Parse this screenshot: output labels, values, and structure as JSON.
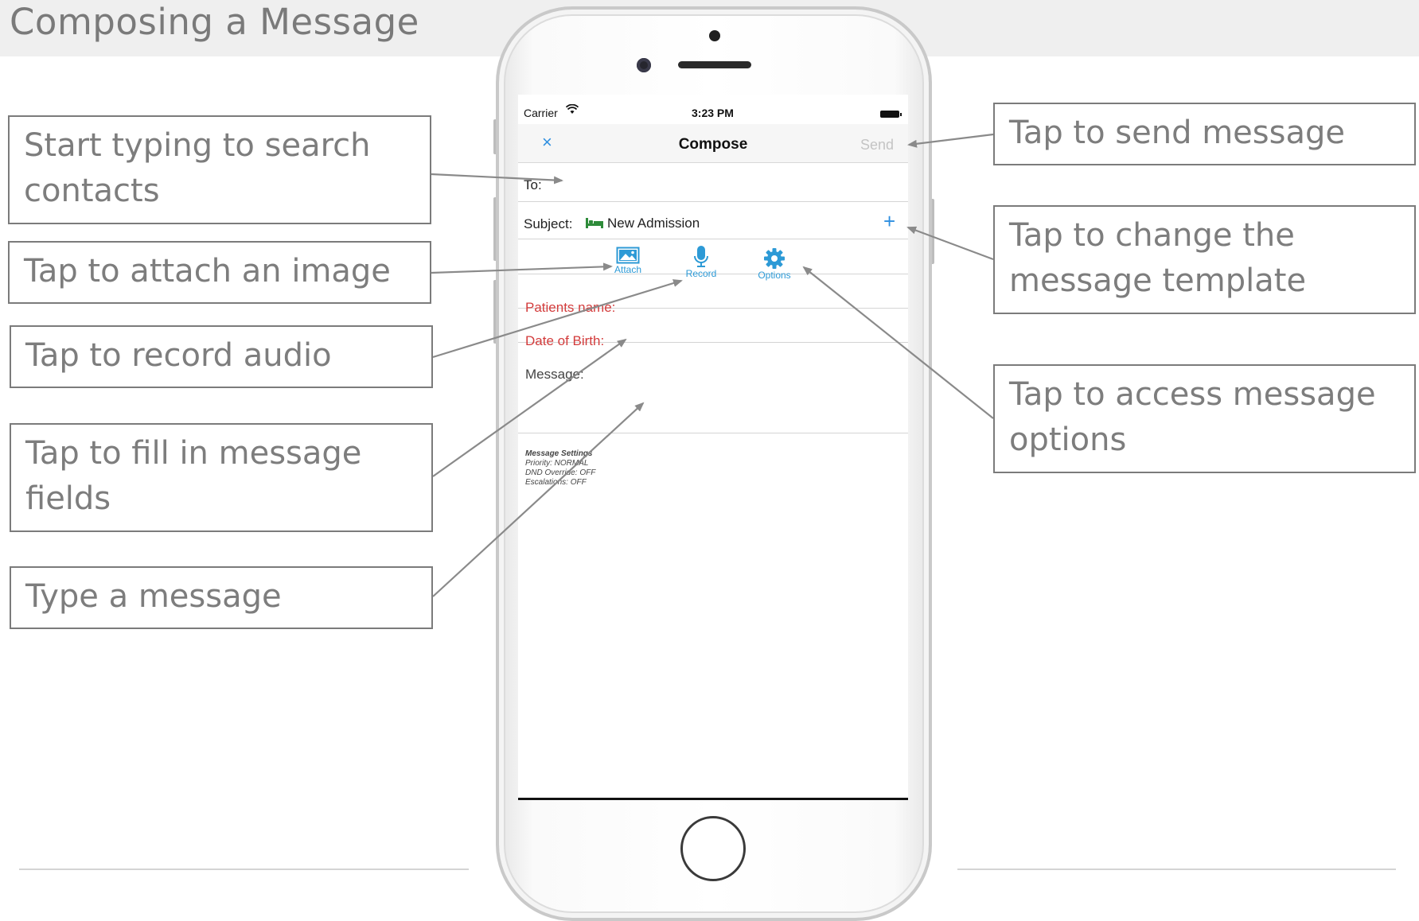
{
  "slide": {
    "title": "Composing a Message"
  },
  "status_bar": {
    "carrier": "Carrier",
    "time": "3:23 PM"
  },
  "nav": {
    "title": "Compose",
    "send_label": "Send",
    "close_glyph": "×"
  },
  "form": {
    "to_label": "To:",
    "subject_label": "Subject:",
    "subject_value": "New Admission",
    "subject_icon": "bed-icon",
    "add_icon": "plus-icon"
  },
  "toolbar": {
    "attach_label": "Attach",
    "record_label": "Record",
    "options_label": "Options"
  },
  "fields": {
    "patient_name": "Patients name:",
    "date_of_birth": "Date of Birth:",
    "message": "Message:"
  },
  "settings": {
    "heading": "Message Settings",
    "priority": "Priority: NORMAL",
    "dnd": "DND Override: OFF",
    "escalations": "Escalations: OFF"
  },
  "callouts": {
    "search_contacts": "Start typing to search contacts",
    "attach_image": "Tap to attach an image",
    "record_audio": "Tap to record audio",
    "fill_fields": "Tap to fill in message fields",
    "type_message": "Type a message",
    "send_message": "Tap to send message",
    "change_template": "Tap to change the message template",
    "message_options": "Tap to access message options"
  },
  "colors": {
    "accent_blue": "#2f8fe0",
    "icon_blue": "#2d9ad6",
    "field_red": "#d33c3c",
    "bed_green": "#2e8b3a",
    "callout_text": "#7d7d7d"
  }
}
